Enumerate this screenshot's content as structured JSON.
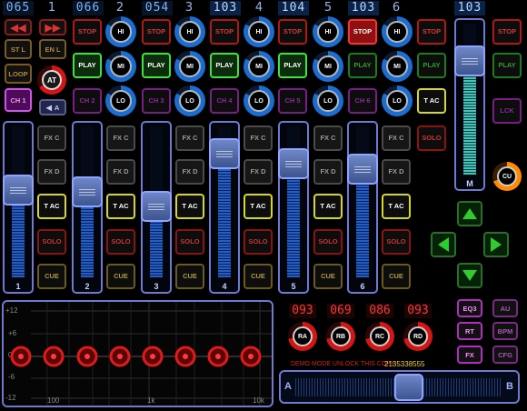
{
  "header": {
    "bpm_readouts": [
      "065",
      "066",
      "054",
      "103",
      "104",
      "103",
      "103"
    ],
    "channel_numbers": [
      "1",
      "2",
      "3",
      "4",
      "5",
      "6"
    ]
  },
  "left_controls": {
    "start_loop": "ST L",
    "end_loop": "EN L",
    "loop": "LOOP",
    "ch1": "CH 1",
    "at_knob": "AT",
    "a_button": "A"
  },
  "transport": {
    "stop": "STOP",
    "play": "PLAY",
    "ch_labels": [
      "CH 2",
      "CH 3",
      "CH 4",
      "CH 5",
      "CH 6"
    ],
    "tac": "T AC",
    "solo": "SOLO",
    "cue": "CUE",
    "fx_c": "FX C",
    "fx_d": "FX D"
  },
  "eq_knobs": {
    "hi": "HI",
    "mi": "MI",
    "lo": "LO"
  },
  "faders": {
    "labels": [
      "1",
      "2",
      "3",
      "4",
      "5",
      "6",
      "M"
    ],
    "levels": [
      0.6,
      0.58,
      0.46,
      0.9,
      0.82,
      0.77,
      0.82
    ]
  },
  "right_panel": {
    "lck": "LCK",
    "cu": "CU",
    "eq3": "EQ3",
    "au": "AU",
    "rt": "RT",
    "bpm": "BPM",
    "fx": "FX",
    "cfg": "CFG"
  },
  "eq_graph": {
    "y_labels": [
      "+12",
      "+6",
      "0db",
      "-6",
      "-12"
    ],
    "x_labels": [
      "100",
      "1k",
      "10k"
    ]
  },
  "rate_section": {
    "readouts": [
      "093",
      "069",
      "086",
      "093"
    ],
    "knobs": [
      "RA",
      "RB",
      "RC",
      "RD"
    ]
  },
  "footer": {
    "demo_text": "DEMO MODE UNLOCK THIS COPY",
    "demo_code": "2135338555",
    "crossfader_a": "A",
    "crossfader_b": "B",
    "crossfader_position": 0.56
  },
  "colors": {
    "accent": "#6d7acf",
    "stop": "#d23a3a",
    "play": "#42e042",
    "tac": "#d7d81d",
    "rate": "#ff3535"
  }
}
